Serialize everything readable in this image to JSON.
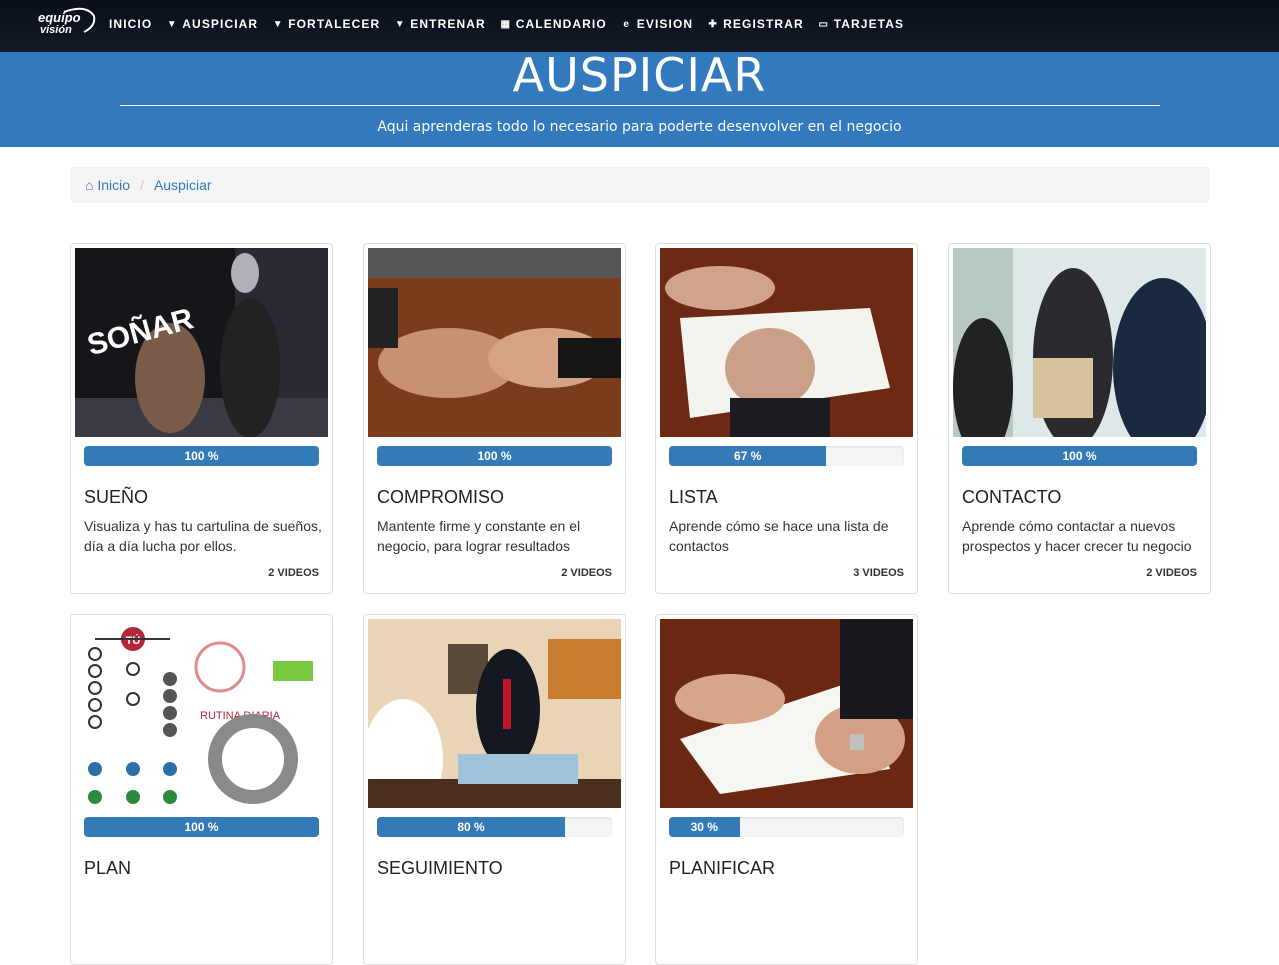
{
  "brand": {
    "line1": "equipo",
    "line2": "visión"
  },
  "nav": [
    {
      "icon": "home-icon",
      "glyph": "",
      "label": "INICIO"
    },
    {
      "icon": "caret-down-icon",
      "glyph": "▼",
      "label": "AUSPICIAR"
    },
    {
      "icon": "caret-down-icon",
      "glyph": "▼",
      "label": "FORTALECER"
    },
    {
      "icon": "caret-down-icon",
      "glyph": "▼",
      "label": "ENTRENAR"
    },
    {
      "icon": "calendar-icon",
      "glyph": "▦",
      "label": "CALENDARIO"
    },
    {
      "icon": "evision-icon",
      "glyph": "e",
      "label": "EVISION"
    },
    {
      "icon": "user-plus-icon",
      "glyph": "✚",
      "label": "REGISTRAR"
    },
    {
      "icon": "id-card-icon",
      "glyph": "▭",
      "label": "TARJETAS"
    }
  ],
  "hero": {
    "title": "AUSPICIAR",
    "subtitle": "Aqui aprenderas todo lo necesario para poderte desenvolver en el negocio",
    "background": "#3279bd"
  },
  "breadcrumb": {
    "home": "Inicio",
    "current": "Auspiciar"
  },
  "cards": [
    {
      "title": "SUEÑO",
      "progress": "100 %",
      "description": "Visualiza y has tu cartulina de sueños, día a día lucha por ellos.",
      "videos": "2 VIDEOS",
      "overlay": "SOÑAR"
    },
    {
      "title": "COMPROMISO",
      "progress": "100 %",
      "description": "Mantente firme y constante en el negocio, para lograr resultados",
      "videos": "2 VIDEOS"
    },
    {
      "title": "LISTA",
      "progress": "67 %",
      "description": "Aprende cómo se hace una lista de contactos",
      "videos": "3 VIDEOS"
    },
    {
      "title": "CONTACTO",
      "progress": "100 %",
      "description": "Aprende cómo contactar a nuevos prospectos y hacer crecer tu negocio",
      "videos": "2 VIDEOS"
    },
    {
      "title": "PLAN",
      "progress": "100 %",
      "description": "",
      "videos": "",
      "overlay": "TÚ",
      "overlay2": "RUTINA DIARIA"
    },
    {
      "title": "SEGUIMIENTO",
      "progress": "80 %",
      "description": "",
      "videos": ""
    },
    {
      "title": "PLANIFICAR",
      "progress": "30 %",
      "description": "",
      "videos": ""
    }
  ]
}
